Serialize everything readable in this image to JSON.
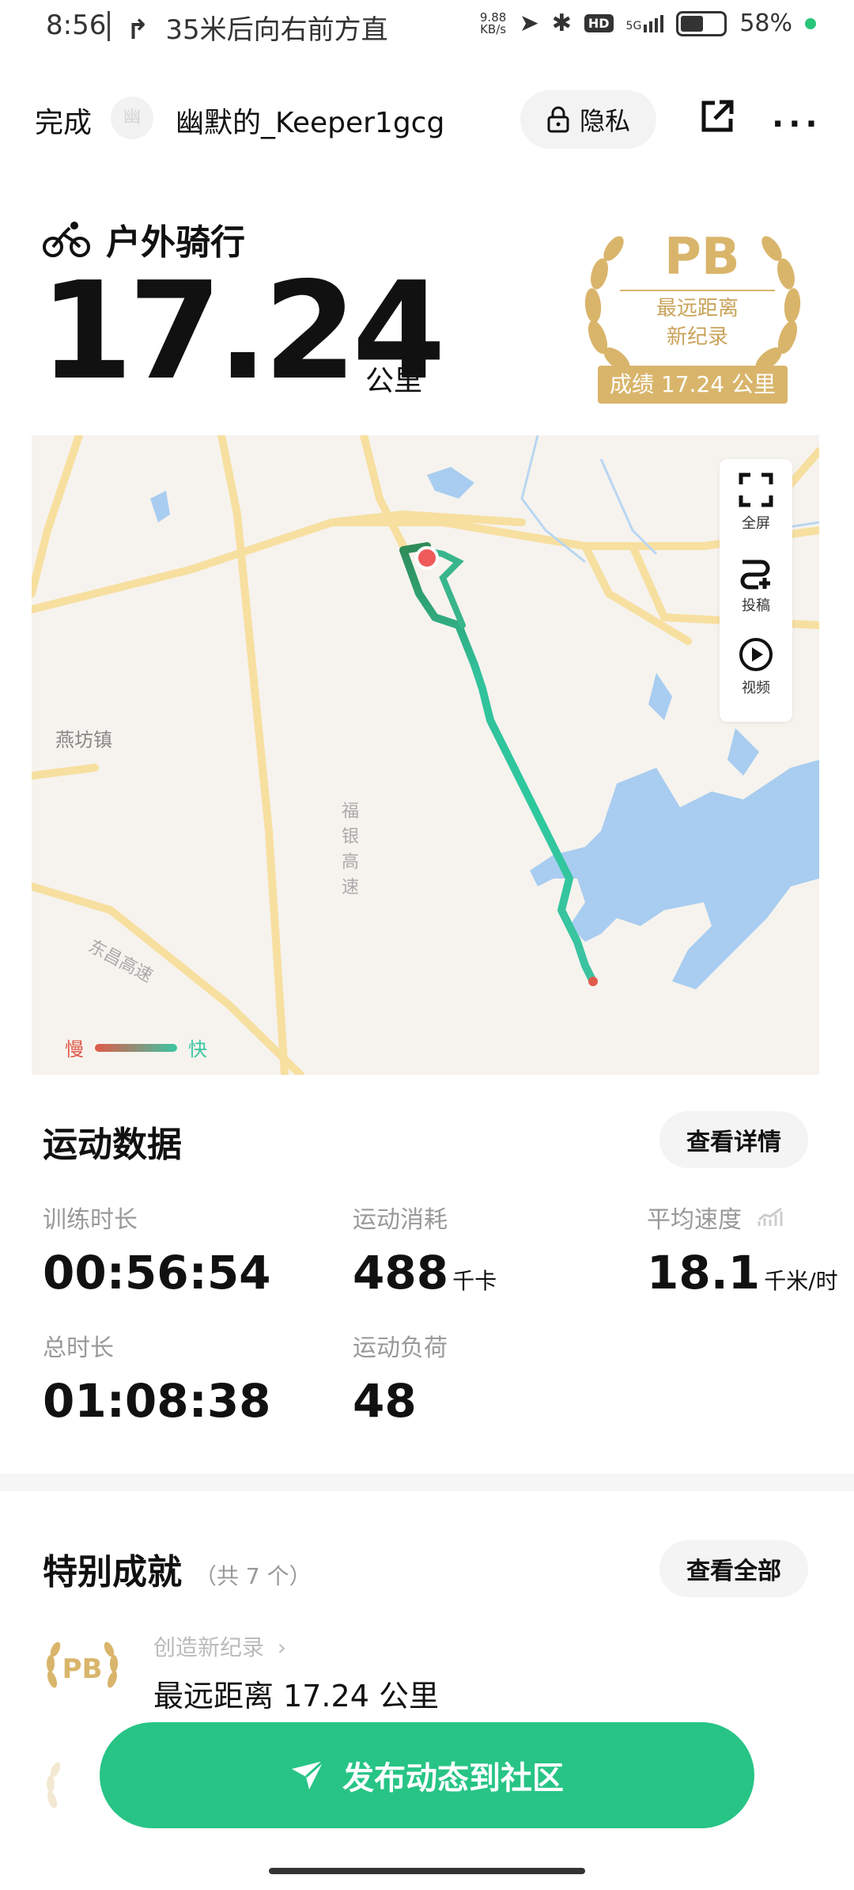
{
  "status_bar": {
    "time": "8:56",
    "navigation": "35米后向右前方直",
    "net_speed": "9.88 KB/s",
    "hd": "HD",
    "network": "5G",
    "battery": "58%"
  },
  "header": {
    "done_label": "完成",
    "avatar_text": "幽",
    "username": "幽默的_Keeper1gcg",
    "privacy_label": "隐私"
  },
  "activity": {
    "type_label": "户外骑行",
    "distance_value": "17.24",
    "distance_unit": "公里"
  },
  "badge": {
    "title": "PB",
    "line1": "最远距离",
    "line2": "新纪录",
    "result": "成绩 17.24 公里"
  },
  "map": {
    "place_label": "燕坊镇",
    "road_label_1": "福银高速",
    "road_label_2": "东昌高速",
    "controls": {
      "fullscreen": "全屏",
      "submit": "投稿",
      "video": "视频"
    },
    "legend_slow": "慢",
    "legend_fast": "快"
  },
  "stats_section": {
    "title": "运动数据",
    "detail_button": "查看详情",
    "items": [
      {
        "label": "训练时长",
        "value": "00:56:54",
        "unit": ""
      },
      {
        "label": "运动消耗",
        "value": "488",
        "unit": "千卡"
      },
      {
        "label": "平均速度",
        "value": "18.1",
        "unit": "千米/时"
      },
      {
        "label": "总时长",
        "value": "01:08:38",
        "unit": ""
      },
      {
        "label": "运动负荷",
        "value": "48",
        "unit": ""
      }
    ]
  },
  "achievements": {
    "title": "特别成就",
    "count": "（共 7 个）",
    "all_button": "查看全部",
    "item_pb": "PB",
    "item_category": "创造新纪录",
    "item_text": "最远距离 17.24 公里"
  },
  "cta": {
    "label": "发布动态到社区"
  },
  "colors": {
    "accent": "#27c485",
    "gold": "#d9b56b",
    "route_start": "#2e8b57",
    "route_end": "#e05a4a"
  }
}
